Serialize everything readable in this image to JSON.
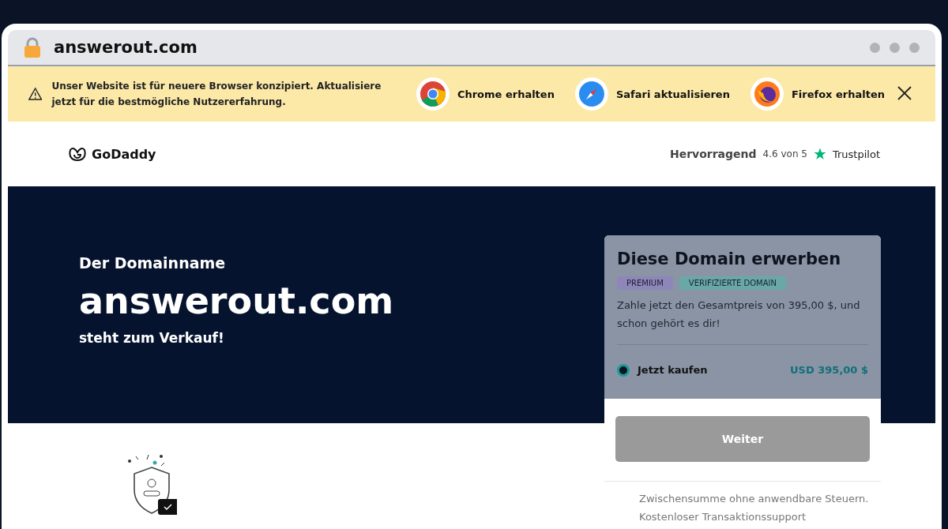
{
  "address_bar": {
    "url": "answerout.com"
  },
  "banner": {
    "message": "Unser Website ist für neuere Browser konzipiert. Aktualisiere jetzt für die bestmögliche Nutzererfahrung.",
    "browsers": [
      {
        "kind": "chrome",
        "label": "Chrome erhalten"
      },
      {
        "kind": "safari",
        "label": "Safari aktualisieren"
      },
      {
        "kind": "firefox",
        "label": "Firefox erhalten"
      }
    ]
  },
  "header": {
    "logo": "GoDaddy",
    "rating_word": "Hervorragend",
    "rating": "4.6 von 5",
    "review_site": "Trustpilot"
  },
  "hero": {
    "kicker": "Der Domainname",
    "domain": "answerout.com",
    "tagline": "steht zum Verkauf!"
  },
  "purchase_card": {
    "title": "Diese Domain erwerben",
    "tags": [
      {
        "label": "PREMIUM",
        "color": "#8e86b8"
      },
      {
        "label": "VERIFIZIERTE DOMAIN",
        "color": "#6aa8a8"
      }
    ],
    "description": "Zahle jetzt den Gesamtpreis von 395,00 $, und schon gehört es dir!",
    "options": [
      {
        "label": "Jetzt kaufen",
        "price": "USD 395,00 $",
        "selected": true
      }
    ],
    "button": "Weiter",
    "notes": [
      "Zwischensumme ohne anwendbare Steuern.",
      "Kostenloser Transaktionssupport"
    ]
  }
}
